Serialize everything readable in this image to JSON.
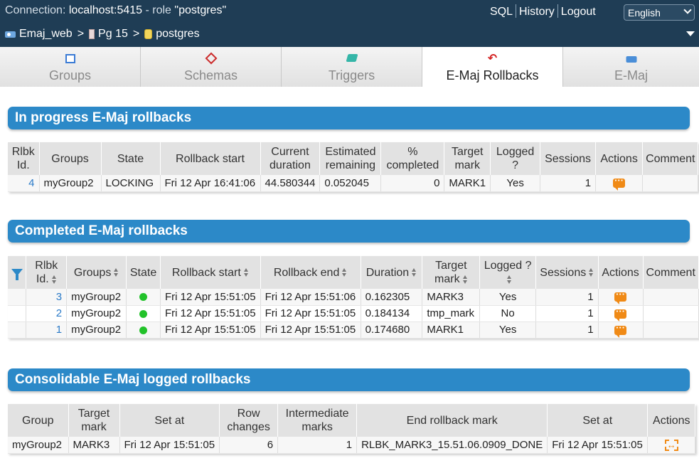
{
  "header": {
    "connection_label": "Connection:",
    "connection_host": "localhost:5415",
    "role_label": "- role",
    "role_value": "\"postgres\"",
    "links": [
      "SQL",
      "History",
      "Logout"
    ],
    "language": "English",
    "breadcrumb": [
      "Emaj_web",
      "Pg 15",
      "postgres"
    ]
  },
  "tabs": [
    {
      "label": "Groups",
      "icon": "groups-icon"
    },
    {
      "label": "Schemas",
      "icon": "schemas-icon"
    },
    {
      "label": "Triggers",
      "icon": "triggers-icon"
    },
    {
      "label": "E-Maj Rollbacks",
      "icon": "rollback-icon",
      "active": true
    },
    {
      "label": "E-Maj",
      "icon": "emaj-icon"
    }
  ],
  "in_progress": {
    "title": "In progress E-Maj rollbacks",
    "headers": [
      "Rlbk Id.",
      "Groups",
      "State",
      "Rollback start",
      "Current duration",
      "Estimated remaining",
      "% completed",
      "Target mark",
      "Logged ?",
      "Sessions",
      "Actions",
      "Comment"
    ],
    "rows": [
      {
        "id": "4",
        "groups": "myGroup2",
        "state": "LOCKING",
        "start": "Fri 12 Apr 16:41:06",
        "duration": "44.580344",
        "remaining": "0.052045",
        "pct": "0",
        "mark": "MARK1",
        "logged": "Yes",
        "sessions": "1",
        "comment": ""
      }
    ]
  },
  "completed": {
    "title": "Completed E-Maj rollbacks",
    "headers": [
      "Rlbk Id.",
      "Groups",
      "State",
      "Rollback start",
      "Rollback end",
      "Duration",
      "Target mark",
      "Logged ?",
      "Sessions",
      "Actions",
      "Comment"
    ],
    "rows": [
      {
        "id": "3",
        "groups": "myGroup2",
        "state_color": "#22c22a",
        "start": "Fri 12 Apr 15:51:05",
        "end": "Fri 12 Apr 15:51:06",
        "duration": "0.162305",
        "mark": "MARK3",
        "logged": "Yes",
        "sessions": "1",
        "comment": ""
      },
      {
        "id": "2",
        "groups": "myGroup2",
        "state_color": "#22c22a",
        "start": "Fri 12 Apr 15:51:05",
        "end": "Fri 12 Apr 15:51:05",
        "duration": "0.184134",
        "mark": "tmp_mark",
        "logged": "No",
        "sessions": "1",
        "comment": ""
      },
      {
        "id": "1",
        "groups": "myGroup2",
        "state_color": "#22c22a",
        "start": "Fri 12 Apr 15:51:05",
        "end": "Fri 12 Apr 15:51:05",
        "duration": "0.174680",
        "mark": "MARK1",
        "logged": "Yes",
        "sessions": "1",
        "comment": ""
      }
    ]
  },
  "consolidable": {
    "title": "Consolidable E-Maj logged rollbacks",
    "headers": [
      "Group",
      "Target mark",
      "Set at",
      "Row changes",
      "Intermediate marks",
      "End rollback mark",
      "Set at",
      "Actions"
    ],
    "rows": [
      {
        "group": "myGroup2",
        "mark": "MARK3",
        "set_at": "Fri 12 Apr 15:51:05",
        "changes": "6",
        "inter": "1",
        "end_mark": "RLBK_MARK3_15.51.06.0909_DONE",
        "end_set_at": "Fri 12 Apr 15:51:05"
      }
    ]
  },
  "colors": {
    "header_bg": "#1f3d55",
    "section_bg": "#2c89c8",
    "action_orange": "#f08a16",
    "ok_green": "#22c22a",
    "link_blue": "#2c7bc8"
  }
}
